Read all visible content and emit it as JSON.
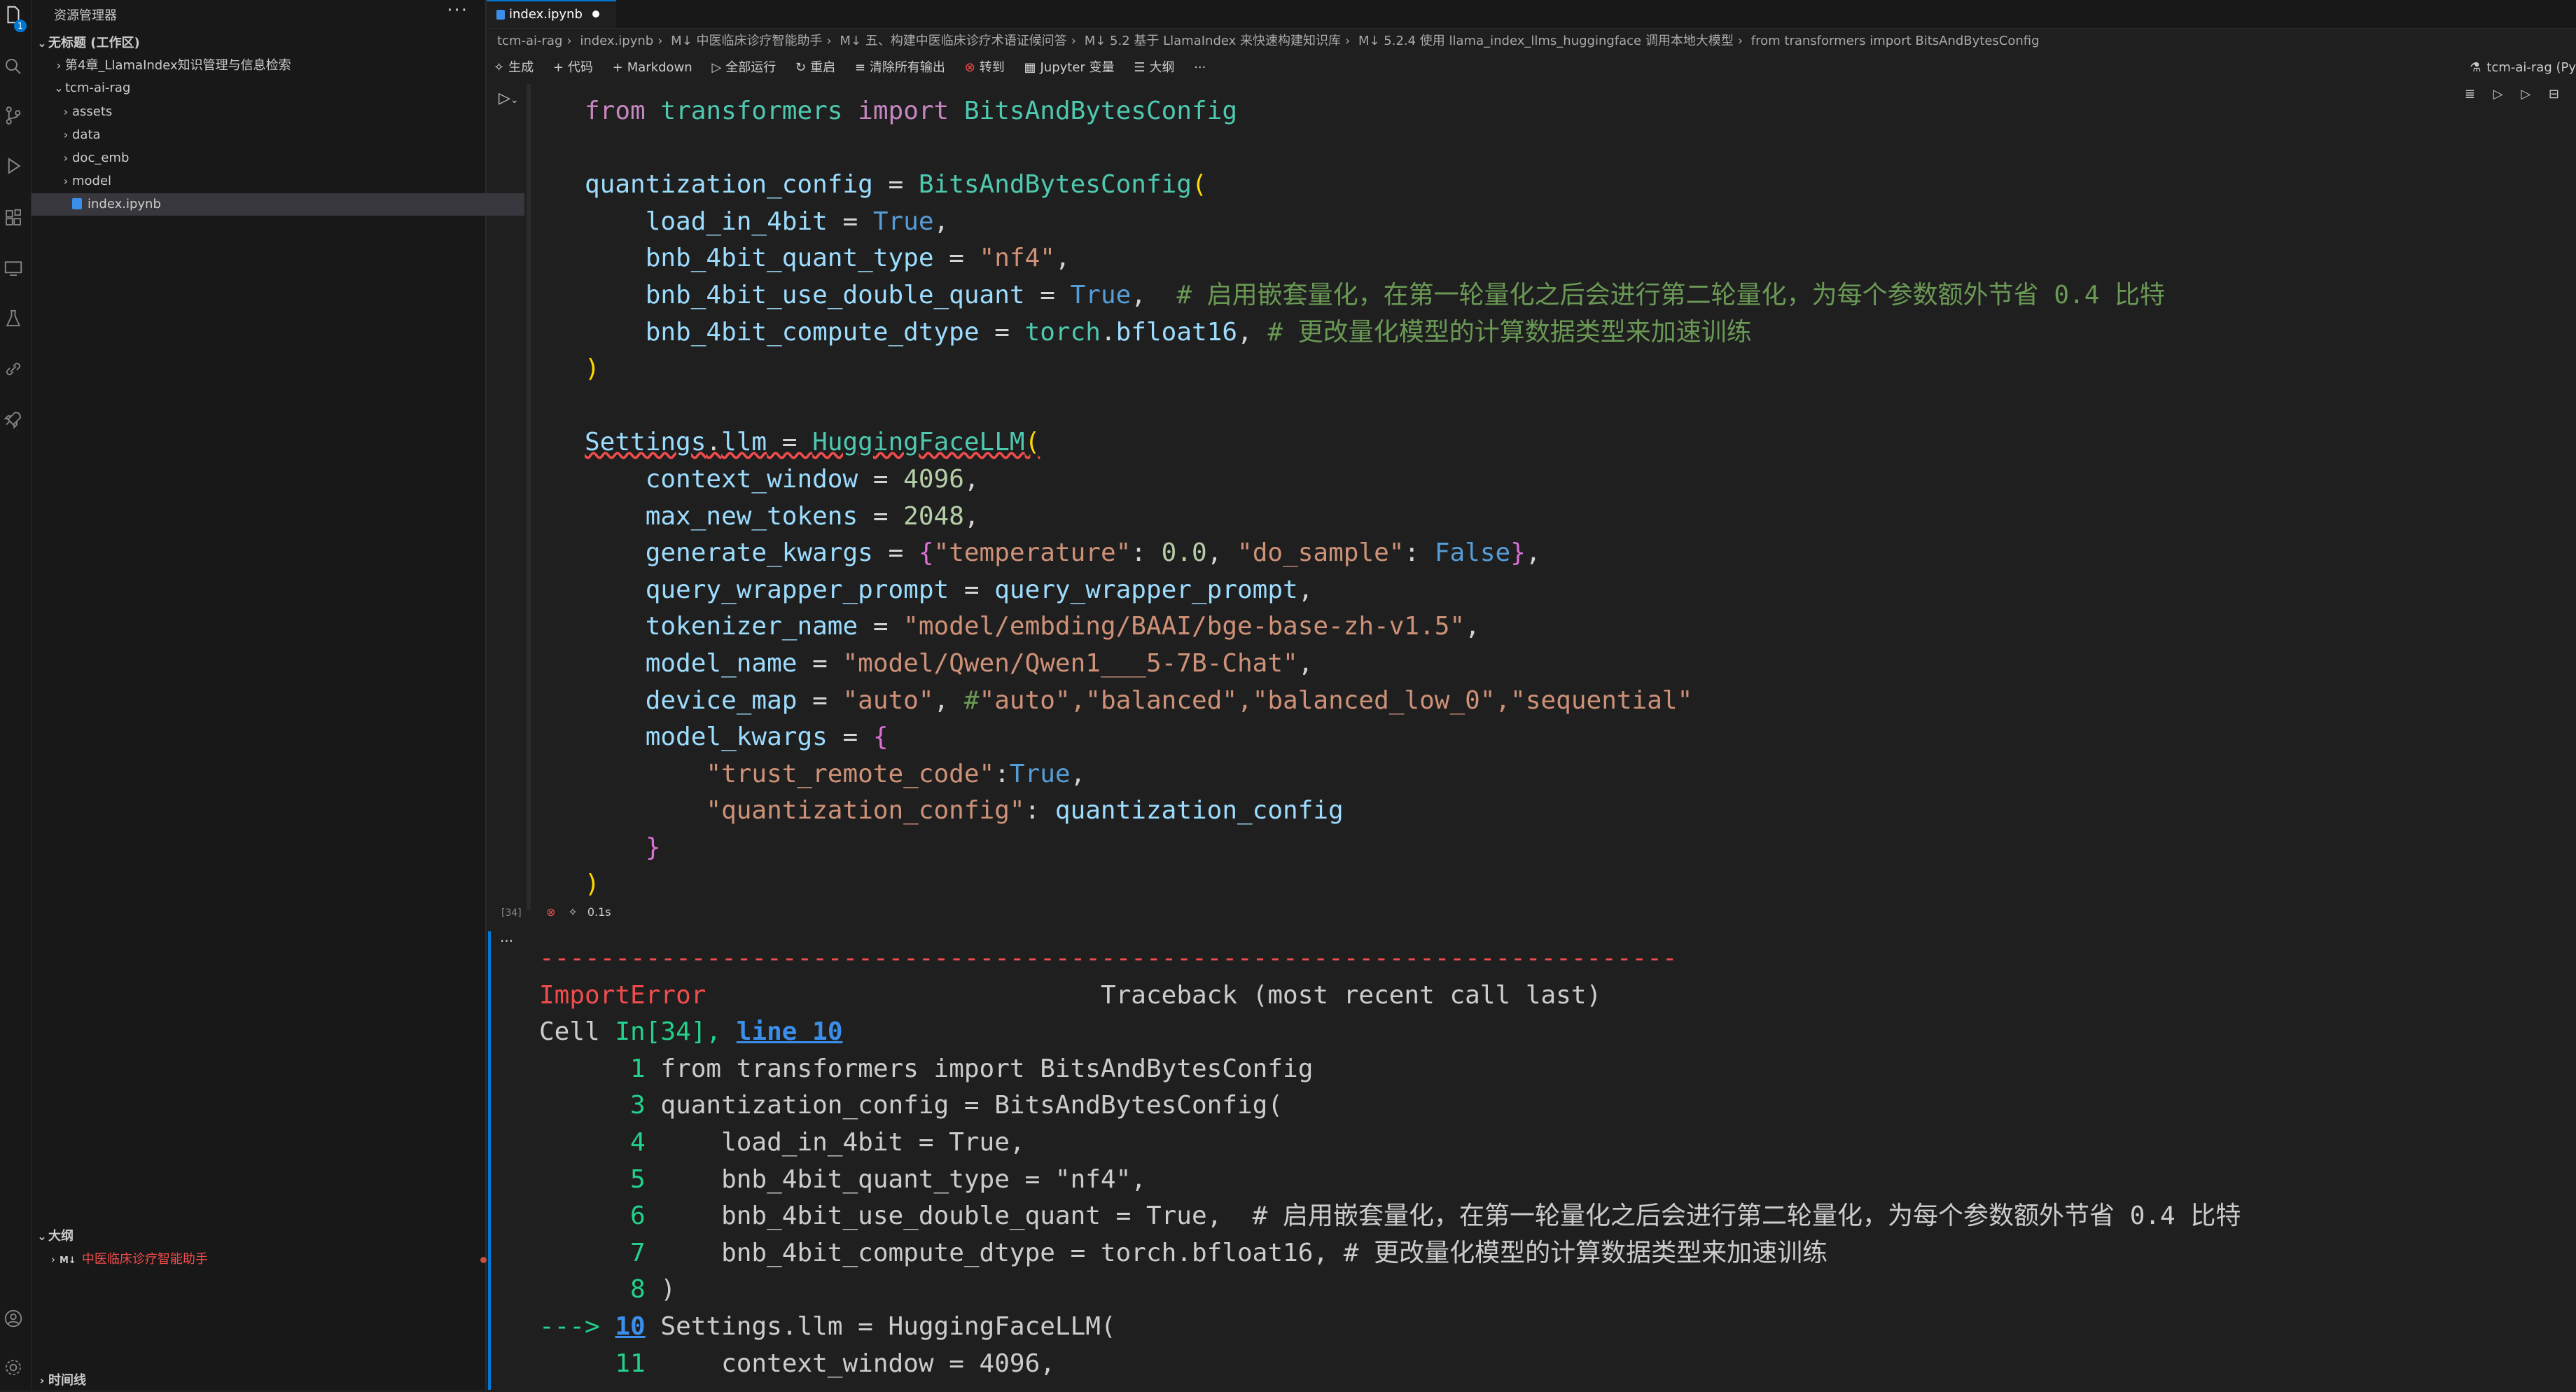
{
  "sidebar": {
    "title": "资源管理器",
    "workspace": "无标题 (工作区)",
    "items": [
      {
        "label": "第4章_LlamaIndex知识管理与信息检索"
      },
      {
        "label": "tcm-ai-rag"
      },
      {
        "label": "assets"
      },
      {
        "label": "data"
      },
      {
        "label": "doc_emb"
      },
      {
        "label": "model"
      },
      {
        "label": "index.ipynb"
      }
    ],
    "outline_title": "大纲",
    "outline_tag": "M↓",
    "outline_item": "中医临床诊疗智能助手",
    "timeline_title": "时间线",
    "badge": "1"
  },
  "tab": {
    "label": "index.ipynb"
  },
  "breadcrumb": [
    "tcm-ai-rag",
    "index.ipynb",
    "M↓ 中医临床诊疗智能助手",
    "M↓ 五、构建中医临床诊疗术语证候问答",
    "M↓ 5.2 基于 LlamaIndex 来快速构建知识库",
    "M↓ 5.2.4 使用 llama_index_llms_huggingface 调用本地大模型",
    "from transformers import BitsAndBytesConfig"
  ],
  "toolbar": {
    "generate": "生成",
    "code": "代码",
    "markdown": "Markdown",
    "run_all": "全部运行",
    "restart": "重启",
    "clear": "清除所有输出",
    "goto": "转到",
    "variables": "Jupyter 变量",
    "outline": "大纲",
    "more": "···",
    "kernel": "tcm-ai-rag (Py"
  },
  "cell": {
    "exec_count": "[34]",
    "duration": "0.1s"
  },
  "output": {
    "dashes": "---------------------------------------------------------------------------",
    "error_name": "ImportError",
    "traceback": "Traceback (most recent call last)",
    "cell_prefix": "Cell ",
    "cell_ref": "In[34],",
    "line_ref": "line 10",
    "arrow": "---> "
  }
}
